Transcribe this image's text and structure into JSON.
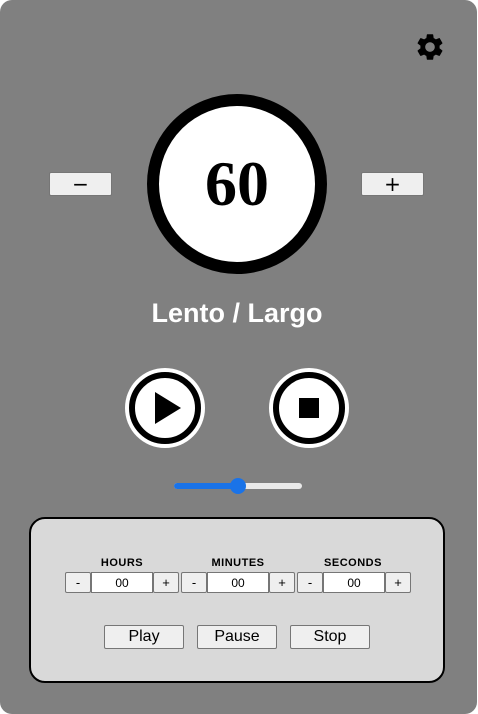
{
  "settings": {
    "icon": "gear-icon"
  },
  "tempo": {
    "bpm": "60",
    "name": "Lento / Largo",
    "decrease_label": "−",
    "increase_label": "+"
  },
  "transport": {
    "play_icon": "play-icon",
    "stop_icon": "stop-icon"
  },
  "volume_slider": {
    "value": 0.5,
    "accent": "#1a73e8"
  },
  "timer": {
    "hours": {
      "label": "HOURS",
      "minus": "-",
      "value": "00",
      "plus": "+"
    },
    "minutes": {
      "label": "MINUTES",
      "minus": "-",
      "value": "00",
      "plus": "+"
    },
    "seconds": {
      "label": "SECONDS",
      "minus": "-",
      "value": "00",
      "plus": "+"
    },
    "play_label": "Play",
    "pause_label": "Pause",
    "stop_label": "Stop"
  },
  "colors": {
    "background": "#808080",
    "panel": "#d9d9d9",
    "dial_ring": "#000000",
    "text_light": "#ffffff"
  }
}
